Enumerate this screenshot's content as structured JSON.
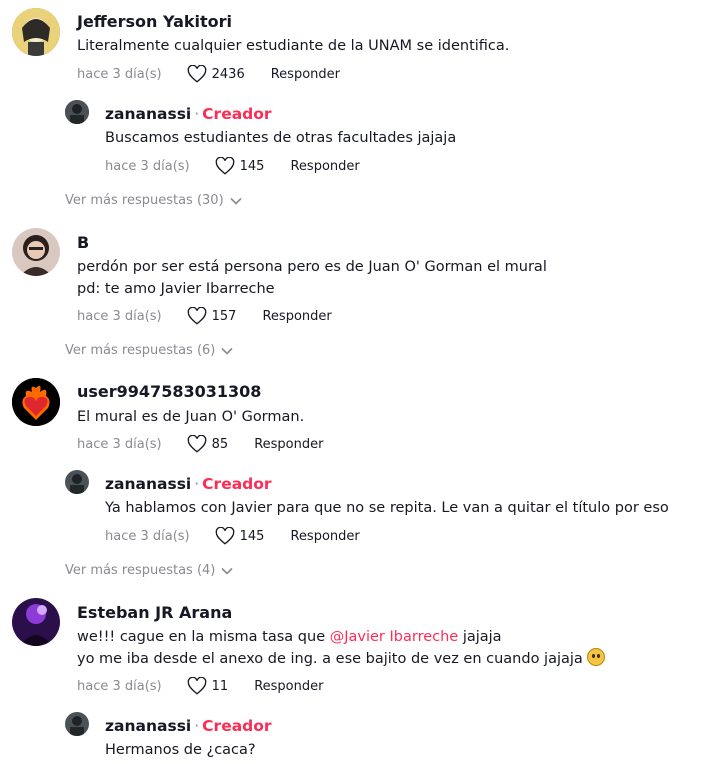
{
  "comments": [
    {
      "user": "Jefferson Yakitori",
      "text": "Literalmente cualquier estudiante de la UNAM se identifica.",
      "time": "hace 3 día(s)",
      "likes": "2436",
      "reply_label": "Responder",
      "replies": [
        {
          "user": "zananassi",
          "badge": "Creador",
          "text": "Buscamos estudiantes de otras facultades jajaja",
          "time": "hace 3 día(s)",
          "likes": "145",
          "reply_label": "Responder"
        }
      ],
      "more_replies": "Ver más respuestas (30)"
    },
    {
      "user": "B",
      "text_line1": "perdón por ser está persona pero es de Juan O' Gorman el mural",
      "text_line2": "pd: te amo Javier Ibarreche",
      "time": "hace 3 día(s)",
      "likes": "157",
      "reply_label": "Responder",
      "more_replies": "Ver más respuestas (6)"
    },
    {
      "user": "user9947583031308",
      "text": "El mural es de Juan O' Gorman.",
      "time": "hace 3 día(s)",
      "likes": "85",
      "reply_label": "Responder",
      "replies": [
        {
          "user": "zananassi",
          "badge": "Creador",
          "text": "Ya hablamos con Javier para que no se repita. Le van a quitar el título por eso",
          "time": "hace 3 día(s)",
          "likes": "145",
          "reply_label": "Responder"
        }
      ],
      "more_replies": "Ver más respuestas (4)"
    },
    {
      "user": "Esteban JR Arana",
      "text_line1_pre": "we!!! cague en la misma tasa que ",
      "mention": "@Javier Ibarreche",
      "text_line1_post": " jajaja",
      "text_line2": "yo me iba desde el anexo de ing. a ese bajito de vez en cuando jajaja",
      "time": "hace 3 día(s)",
      "likes": "11",
      "reply_label": "Responder",
      "replies": [
        {
          "user": "zananassi",
          "badge": "Creador",
          "text": "Hermanos de ¿caca?"
        }
      ]
    }
  ],
  "separator": "·",
  "colors": {
    "creator": "#fe2c55",
    "muted": "#8a8b91",
    "text": "#161823"
  }
}
